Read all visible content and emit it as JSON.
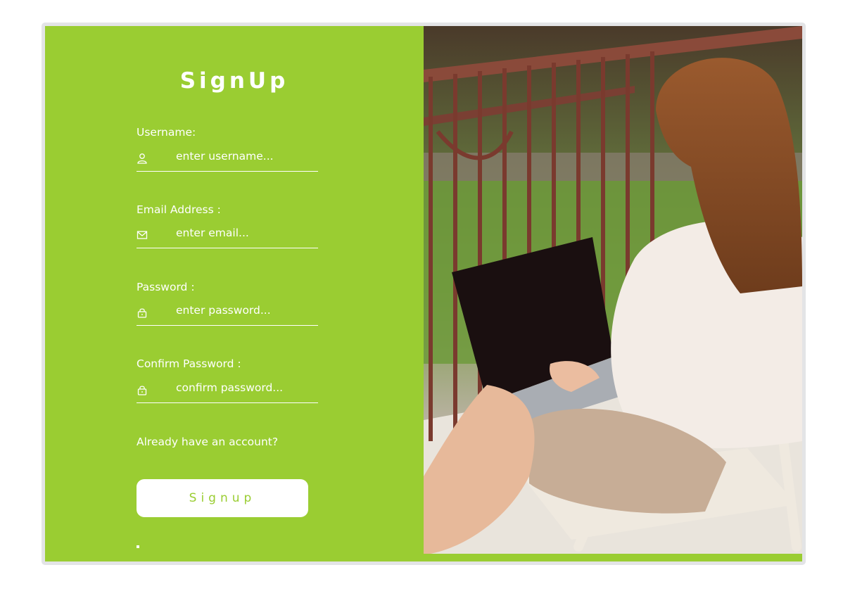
{
  "form": {
    "title": "SignUp",
    "fields": [
      {
        "label": "Username:",
        "placeholder": "enter username...",
        "icon": "user-icon"
      },
      {
        "label": "Email Address :",
        "placeholder": "enter email...",
        "icon": "mail-icon"
      },
      {
        "label": "Password :",
        "placeholder": "enter password...",
        "icon": "lock-icon"
      },
      {
        "label": "Confirm Password :",
        "placeholder": "confirm password...",
        "icon": "lock-icon"
      }
    ],
    "login_link": "Already have an account?",
    "submit_label": "Signup"
  },
  "colors": {
    "accent": "#9acd32",
    "text": "#ffffff",
    "button_bg": "#ffffff",
    "border": "#e3e4e6"
  },
  "image": {
    "subject": "woman-with-laptop-on-balcony"
  }
}
